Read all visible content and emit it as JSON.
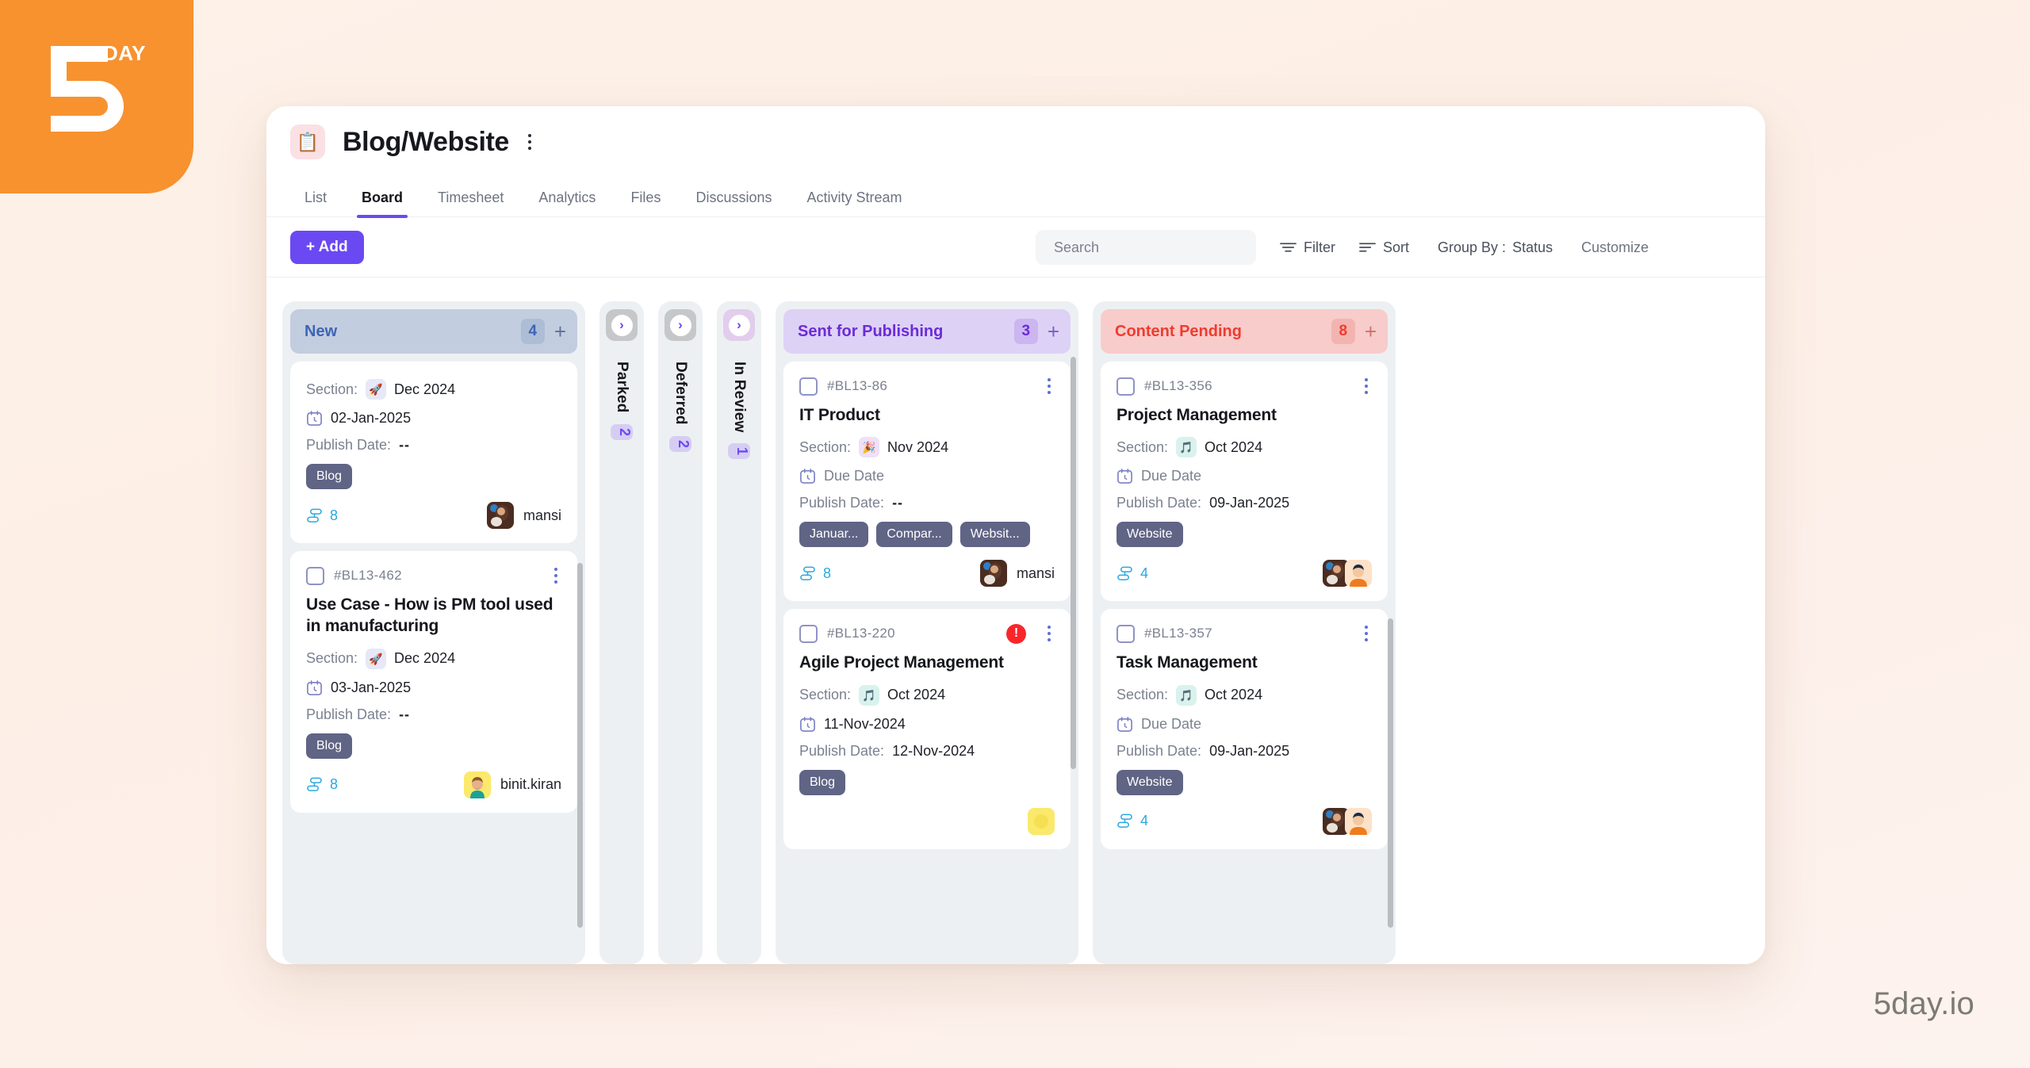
{
  "brand": {
    "logo_text": "5",
    "logo_suffix": "DAY",
    "watermark": "5day.io"
  },
  "header": {
    "title": "Blog/Website",
    "icon": "clipboard-icon",
    "more_icon": "kebab-menu-icon"
  },
  "tabs": [
    {
      "label": "List",
      "active": false
    },
    {
      "label": "Board",
      "active": true
    },
    {
      "label": "Timesheet",
      "active": false
    },
    {
      "label": "Analytics",
      "active": false
    },
    {
      "label": "Files",
      "active": false
    },
    {
      "label": "Discussions",
      "active": false
    },
    {
      "label": "Activity Stream",
      "active": false
    }
  ],
  "toolbar": {
    "add_label": "+ Add",
    "search_placeholder": "Search",
    "search_value": "",
    "search_icon": "search-icon",
    "info_icon": "info-icon",
    "filter_label": "Filter",
    "sort_label": "Sort",
    "group_by_label": "Group By :",
    "group_by_value": "Status",
    "customize_label": "Customize"
  },
  "board": {
    "columns": [
      {
        "id": "new",
        "name": "New",
        "count": "4",
        "collapsed": false,
        "theme": "new",
        "cards": [
          {
            "id": "",
            "title": "",
            "section_label": "Section:",
            "section_value": "Dec 2024",
            "section_icon": "rocket-emoji",
            "section_theme": "chip-dec",
            "due_date": "02-Jan-2025",
            "publish_label": "Publish Date:",
            "publish_value": "--",
            "tags": [
              "Blog"
            ],
            "subtask_count": "8",
            "assignee": "mansi",
            "alert": false,
            "show_header": false
          },
          {
            "id": "#BL13-462",
            "title": "Use Case - How is PM tool used in manufacturing",
            "section_label": "Section:",
            "section_value": "Dec 2024",
            "section_icon": "rocket-emoji",
            "section_theme": "chip-dec",
            "due_date": "03-Jan-2025",
            "publish_label": "Publish Date:",
            "publish_value": "--",
            "tags": [
              "Blog"
            ],
            "subtask_count": "8",
            "assignee": "binit.kiran",
            "alert": false,
            "show_header": true
          }
        ]
      },
      {
        "id": "parked",
        "name": "Parked",
        "count": "2",
        "collapsed": true,
        "head_theme": "gray"
      },
      {
        "id": "deferred",
        "name": "Deferred",
        "count": "2",
        "collapsed": true,
        "head_theme": "gray"
      },
      {
        "id": "inreview",
        "name": "In Review",
        "count": "1",
        "collapsed": true,
        "head_theme": "purple"
      },
      {
        "id": "publishing",
        "name": "Sent for Publishing",
        "count": "3",
        "collapsed": false,
        "theme": "publishing",
        "cards": [
          {
            "id": "#BL13-86",
            "title": "IT Product",
            "section_label": "Section:",
            "section_value": "Nov 2024",
            "section_icon": "confetti-emoji",
            "section_theme": "chip-nov",
            "due_date": "Due Date",
            "publish_label": "Publish Date:",
            "publish_value": "--",
            "tags": [
              "Januar...",
              "Compar...",
              "Websit..."
            ],
            "subtask_count": "8",
            "assignee": "mansi",
            "alert": false,
            "show_header": true
          },
          {
            "id": "#BL13-220",
            "title": "Agile Project Management",
            "section_label": "Section:",
            "section_value": "Oct 2024",
            "section_icon": "music-note-emoji",
            "section_theme": "chip-oct",
            "due_date": "11-Nov-2024",
            "publish_label": "Publish Date:",
            "publish_value": "12-Nov-2024",
            "tags": [
              "Blog"
            ],
            "subtask_count": "",
            "assignee": "",
            "alert": true,
            "show_header": true
          }
        ]
      },
      {
        "id": "pending",
        "name": "Content Pending",
        "count": "8",
        "collapsed": false,
        "theme": "pending",
        "cards": [
          {
            "id": "#BL13-356",
            "title": "Project Management",
            "section_label": "Section:",
            "section_value": "Oct 2024",
            "section_icon": "music-note-emoji",
            "section_theme": "chip-oct",
            "due_date": "Due Date",
            "publish_label": "Publish Date:",
            "publish_value": "09-Jan-2025",
            "tags": [
              "Website"
            ],
            "subtask_count": "4",
            "assignee": "",
            "alert": false,
            "show_header": true
          },
          {
            "id": "#BL13-357",
            "title": "Task Management",
            "section_label": "Section:",
            "section_value": "Oct 2024",
            "section_icon": "music-note-emoji",
            "section_theme": "chip-oct",
            "due_date": "Due Date",
            "publish_label": "Publish Date:",
            "publish_value": "09-Jan-2025",
            "tags": [
              "Website"
            ],
            "subtask_count": "4",
            "assignee": "",
            "alert": false,
            "show_header": true
          }
        ]
      }
    ]
  },
  "colors": {
    "brand_orange": "#F7922F",
    "accent_purple": "#6B49F2",
    "status_new": "#3D64B5",
    "status_publishing": "#6B2CD6",
    "status_pending": "#F03B30",
    "tag_slate": "#606485",
    "subtask_blue": "#2AA8E0"
  }
}
